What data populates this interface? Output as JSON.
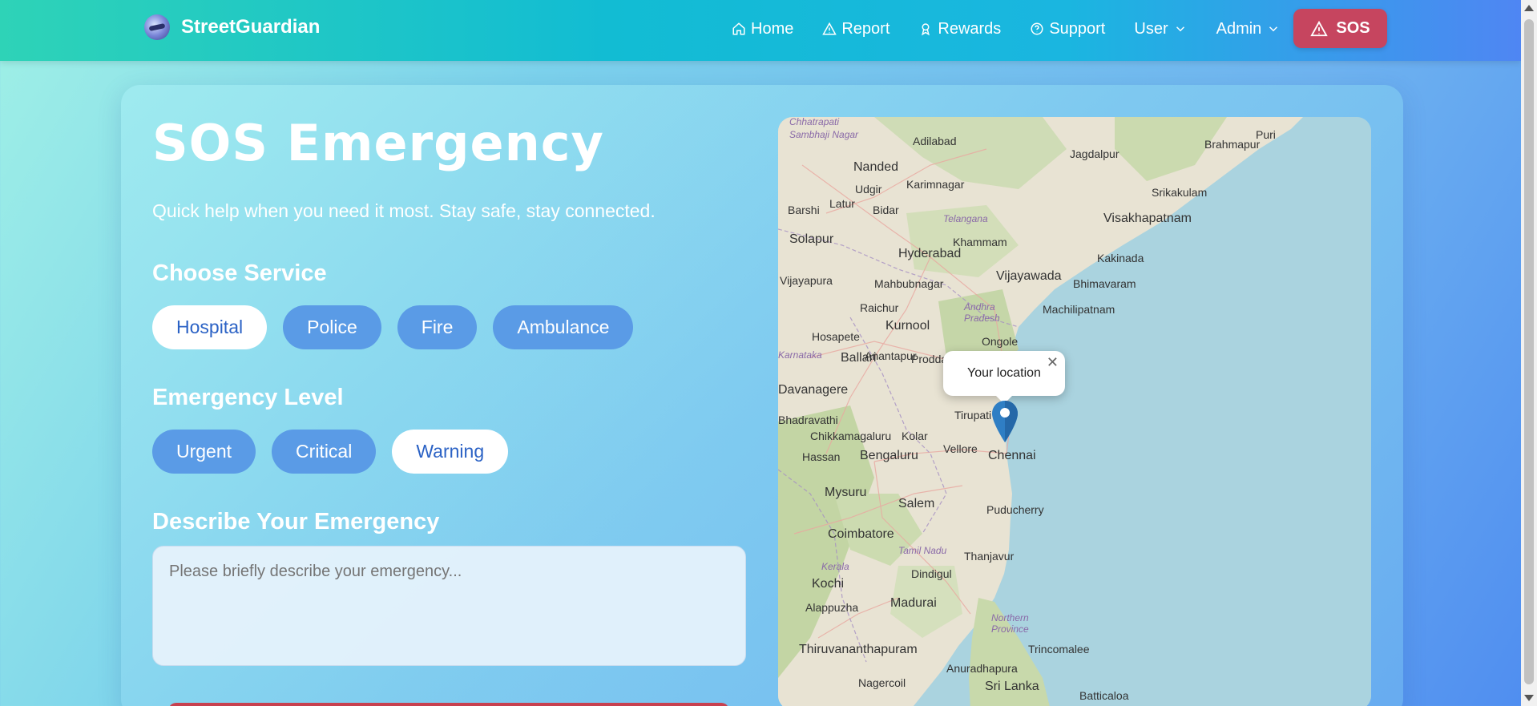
{
  "brand": {
    "name": "StreetGuardian"
  },
  "nav": {
    "items": [
      {
        "label": "Home",
        "icon": "home-icon"
      },
      {
        "label": "Report",
        "icon": "warning-icon"
      },
      {
        "label": "Rewards",
        "icon": "award-icon"
      },
      {
        "label": "Support",
        "icon": "help-circle-icon"
      },
      {
        "label": "User",
        "icon": "chevron-down-icon"
      },
      {
        "label": "Admin",
        "icon": "chevron-down-icon"
      }
    ],
    "sos_label": "SOS"
  },
  "page": {
    "title": "SOS Emergency",
    "subtitle": "Quick help when you need it most. Stay safe, stay connected."
  },
  "service": {
    "label": "Choose Service",
    "options": [
      "Hospital",
      "Police",
      "Fire",
      "Ambulance"
    ],
    "selected": "Hospital"
  },
  "level": {
    "label": "Emergency Level",
    "options": [
      "Urgent",
      "Critical",
      "Warning"
    ],
    "selected": "Warning"
  },
  "describe": {
    "label": "Describe Your Emergency",
    "placeholder": "Please briefly describe your emergency...",
    "value": ""
  },
  "map": {
    "popup_text": "Your location",
    "cities": [
      "Chhatrapati Sambhaji Nagar",
      "Adilabad",
      "Jagdalpur",
      "Brahmapur",
      "Puri",
      "Nanded",
      "Karimnagar",
      "Srikakulam",
      "Udgir",
      "Latur",
      "Bidar",
      "Barshi",
      "Telangana",
      "Visakhapatnam",
      "Solapur",
      "Khammam",
      "Hyderabad",
      "Kakinada",
      "Vijayapura",
      "Mahbubnagar",
      "Vijayawada",
      "Bhimavaram",
      "Raichur",
      "Machilipatnam",
      "Kurnool",
      "Andhra Pradesh",
      "Hosapete",
      "Ongole",
      "Ballari",
      "Anantapur",
      "Proddatur",
      "Karnataka",
      "Davanagere",
      "Tirupati",
      "Bhadravathi",
      "Chikkamagaluru",
      "Kolar",
      "Vellore",
      "Chennai",
      "Hassan",
      "Bengaluru",
      "Mysuru",
      "Salem",
      "Puducherry",
      "Coimbatore",
      "Tamil Nadu",
      "Thanjavur",
      "Kerala",
      "Dindigul",
      "Kochi",
      "Alappuzha",
      "Madurai",
      "Northern Province",
      "Thiruvananthapuram",
      "Trincomalee",
      "Anuradhapura",
      "Nagercoil",
      "Sri Lanka",
      "Batticaloa"
    ]
  },
  "colors": {
    "sos": "#c6455f",
    "pill": "#5a9be6",
    "pill_active_text": "#2b62c5"
  }
}
